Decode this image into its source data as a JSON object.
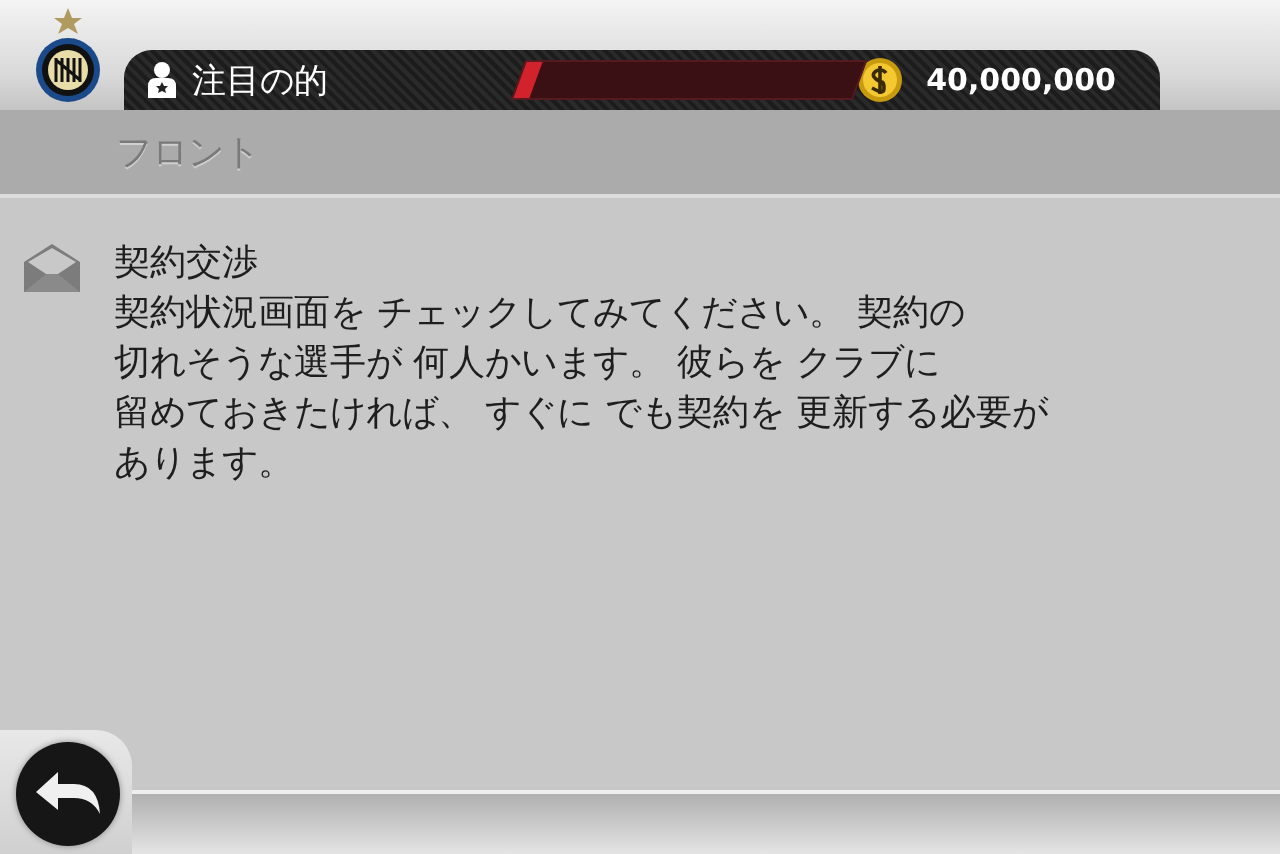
{
  "header": {
    "title": "注目の的",
    "gauge": {
      "level": 0.05
    },
    "money": "40,000,000"
  },
  "section": {
    "title": "フロント"
  },
  "messages": [
    {
      "kind": "mail",
      "title": "契約交渉",
      "body_lines": [
        "契約状況画面を チェックしてみてください。 契約の",
        "切れそうな選手が 何人かいます。 彼らを クラブに",
        "留めておきたければ、 すぐに でも契約を 更新する必要が",
        "あります。"
      ]
    }
  ]
}
